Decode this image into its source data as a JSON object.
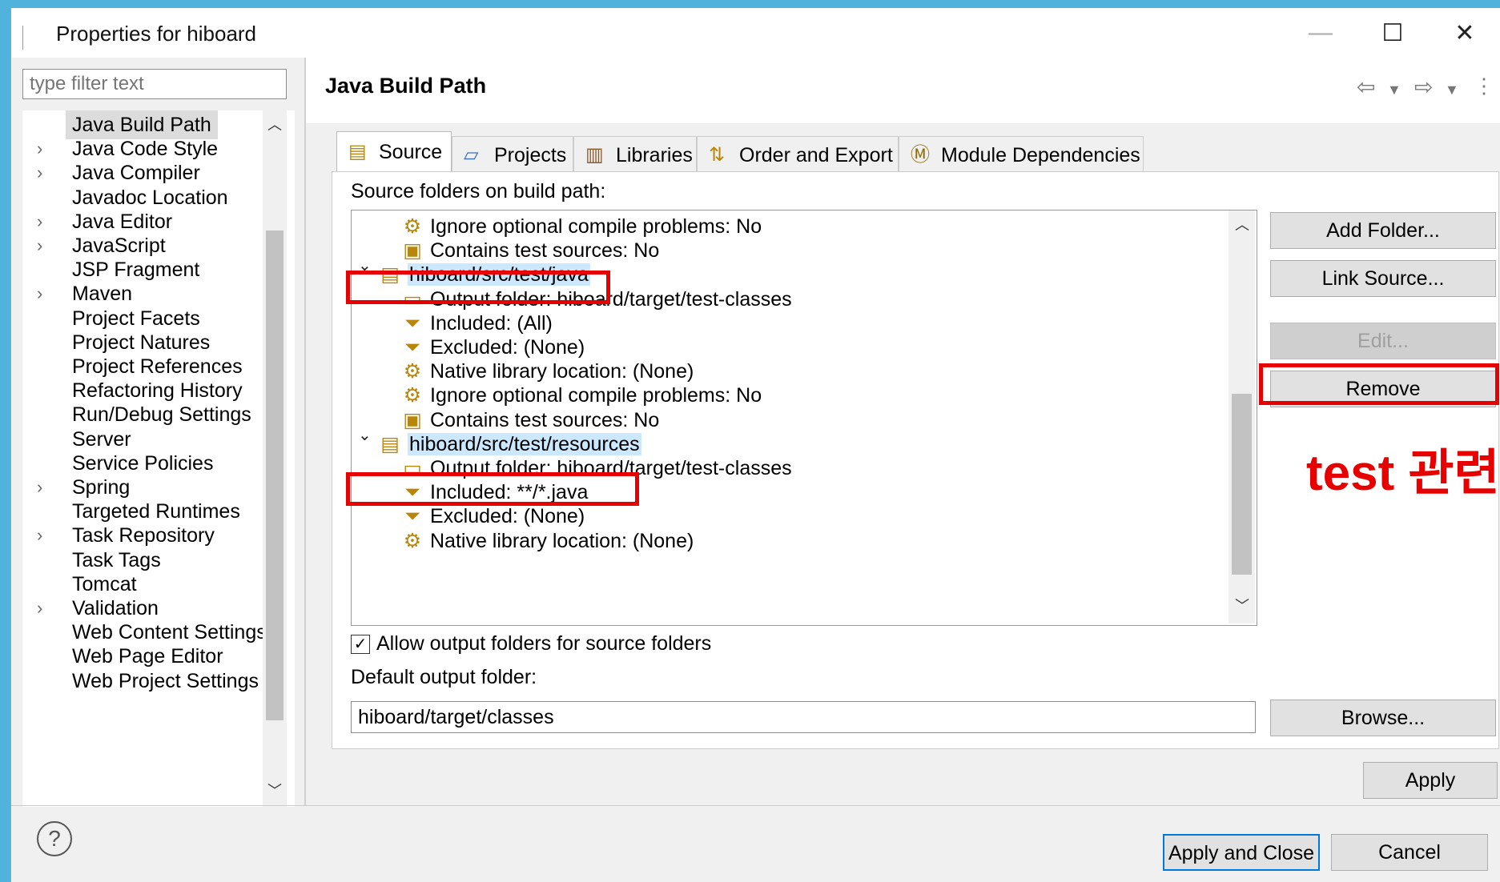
{
  "window": {
    "title": "Properties for hiboard",
    "minimize": "—",
    "maximize": "☐",
    "close": "✕"
  },
  "filter": {
    "placeholder": "type filter text"
  },
  "nav": {
    "items": [
      {
        "label": "Java Build Path",
        "arrow": "",
        "selected": true
      },
      {
        "label": "Java Code Style",
        "arrow": "›"
      },
      {
        "label": "Java Compiler",
        "arrow": "›"
      },
      {
        "label": "Javadoc Location",
        "arrow": ""
      },
      {
        "label": "Java Editor",
        "arrow": "›"
      },
      {
        "label": "JavaScript",
        "arrow": "›"
      },
      {
        "label": "JSP Fragment",
        "arrow": ""
      },
      {
        "label": "Maven",
        "arrow": "›"
      },
      {
        "label": "Project Facets",
        "arrow": ""
      },
      {
        "label": "Project Natures",
        "arrow": ""
      },
      {
        "label": "Project References",
        "arrow": ""
      },
      {
        "label": "Refactoring History",
        "arrow": ""
      },
      {
        "label": "Run/Debug Settings",
        "arrow": ""
      },
      {
        "label": "Server",
        "arrow": ""
      },
      {
        "label": "Service Policies",
        "arrow": ""
      },
      {
        "label": "Spring",
        "arrow": "›"
      },
      {
        "label": "Targeted Runtimes",
        "arrow": ""
      },
      {
        "label": "Task Repository",
        "arrow": "›"
      },
      {
        "label": "Task Tags",
        "arrow": ""
      },
      {
        "label": "Tomcat",
        "arrow": ""
      },
      {
        "label": "Validation",
        "arrow": "›"
      },
      {
        "label": "Web Content Settings",
        "arrow": ""
      },
      {
        "label": "Web Page Editor",
        "arrow": ""
      },
      {
        "label": "Web Project Settings",
        "arrow": ""
      }
    ]
  },
  "page": {
    "title": "Java Build Path"
  },
  "tabs": [
    {
      "label": "Source",
      "icon": "source-tab-icon"
    },
    {
      "label": "Projects",
      "icon": "projects-tab-icon"
    },
    {
      "label": "Libraries",
      "icon": "libraries-tab-icon"
    },
    {
      "label": "Order and Export",
      "icon": "order-export-tab-icon"
    },
    {
      "label": "Module Dependencies",
      "icon": "module-tab-icon"
    }
  ],
  "source": {
    "label": "Source folders on build path:",
    "rows": [
      {
        "text": "Ignore optional compile problems: No",
        "kind": "attr",
        "icon": "ignore-problems-icon"
      },
      {
        "text": "Contains test sources: No",
        "kind": "attr",
        "icon": "test-sources-icon"
      },
      {
        "text": "hiboard/src/test/java",
        "kind": "folder",
        "icon": "source-folder-icon"
      },
      {
        "text": "Output folder: hiboard/target/test-classes",
        "kind": "attr",
        "icon": "output-folder-icon"
      },
      {
        "text": "Included: (All)",
        "kind": "attr",
        "icon": "include-filter-icon"
      },
      {
        "text": "Excluded: (None)",
        "kind": "attr",
        "icon": "exclude-filter-icon"
      },
      {
        "text": "Native library location: (None)",
        "kind": "attr",
        "icon": "native-library-icon"
      },
      {
        "text": "Ignore optional compile problems: No",
        "kind": "attr",
        "icon": "ignore-problems-icon"
      },
      {
        "text": "Contains test sources: No",
        "kind": "attr",
        "icon": "test-sources-icon"
      },
      {
        "text": "hiboard/src/test/resources",
        "kind": "folder",
        "icon": "source-folder-icon"
      },
      {
        "text": "Output folder: hiboard/target/test-classes",
        "kind": "attr",
        "icon": "output-folder-icon"
      },
      {
        "text": "Included: **/*.java",
        "kind": "attr",
        "icon": "include-filter-icon"
      },
      {
        "text": "Excluded: (None)",
        "kind": "attr",
        "icon": "exclude-filter-icon"
      },
      {
        "text": "Native library location: (None)",
        "kind": "attr",
        "icon": "native-library-icon"
      }
    ]
  },
  "buttons": {
    "add_folder": "Add Folder...",
    "link_source": "Link Source...",
    "edit": "Edit...",
    "remove": "Remove",
    "browse": "Browse...",
    "apply": "Apply",
    "apply_close": "Apply and Close",
    "cancel": "Cancel"
  },
  "annotation": "test 관련",
  "allow_output": {
    "label": "Allow output folders for source folders",
    "checked": true
  },
  "default_output": {
    "label": "Default output folder:",
    "value": "hiboard/target/classes"
  },
  "colors": {
    "highlight": "#e60000",
    "selection": "#cce8ff"
  }
}
